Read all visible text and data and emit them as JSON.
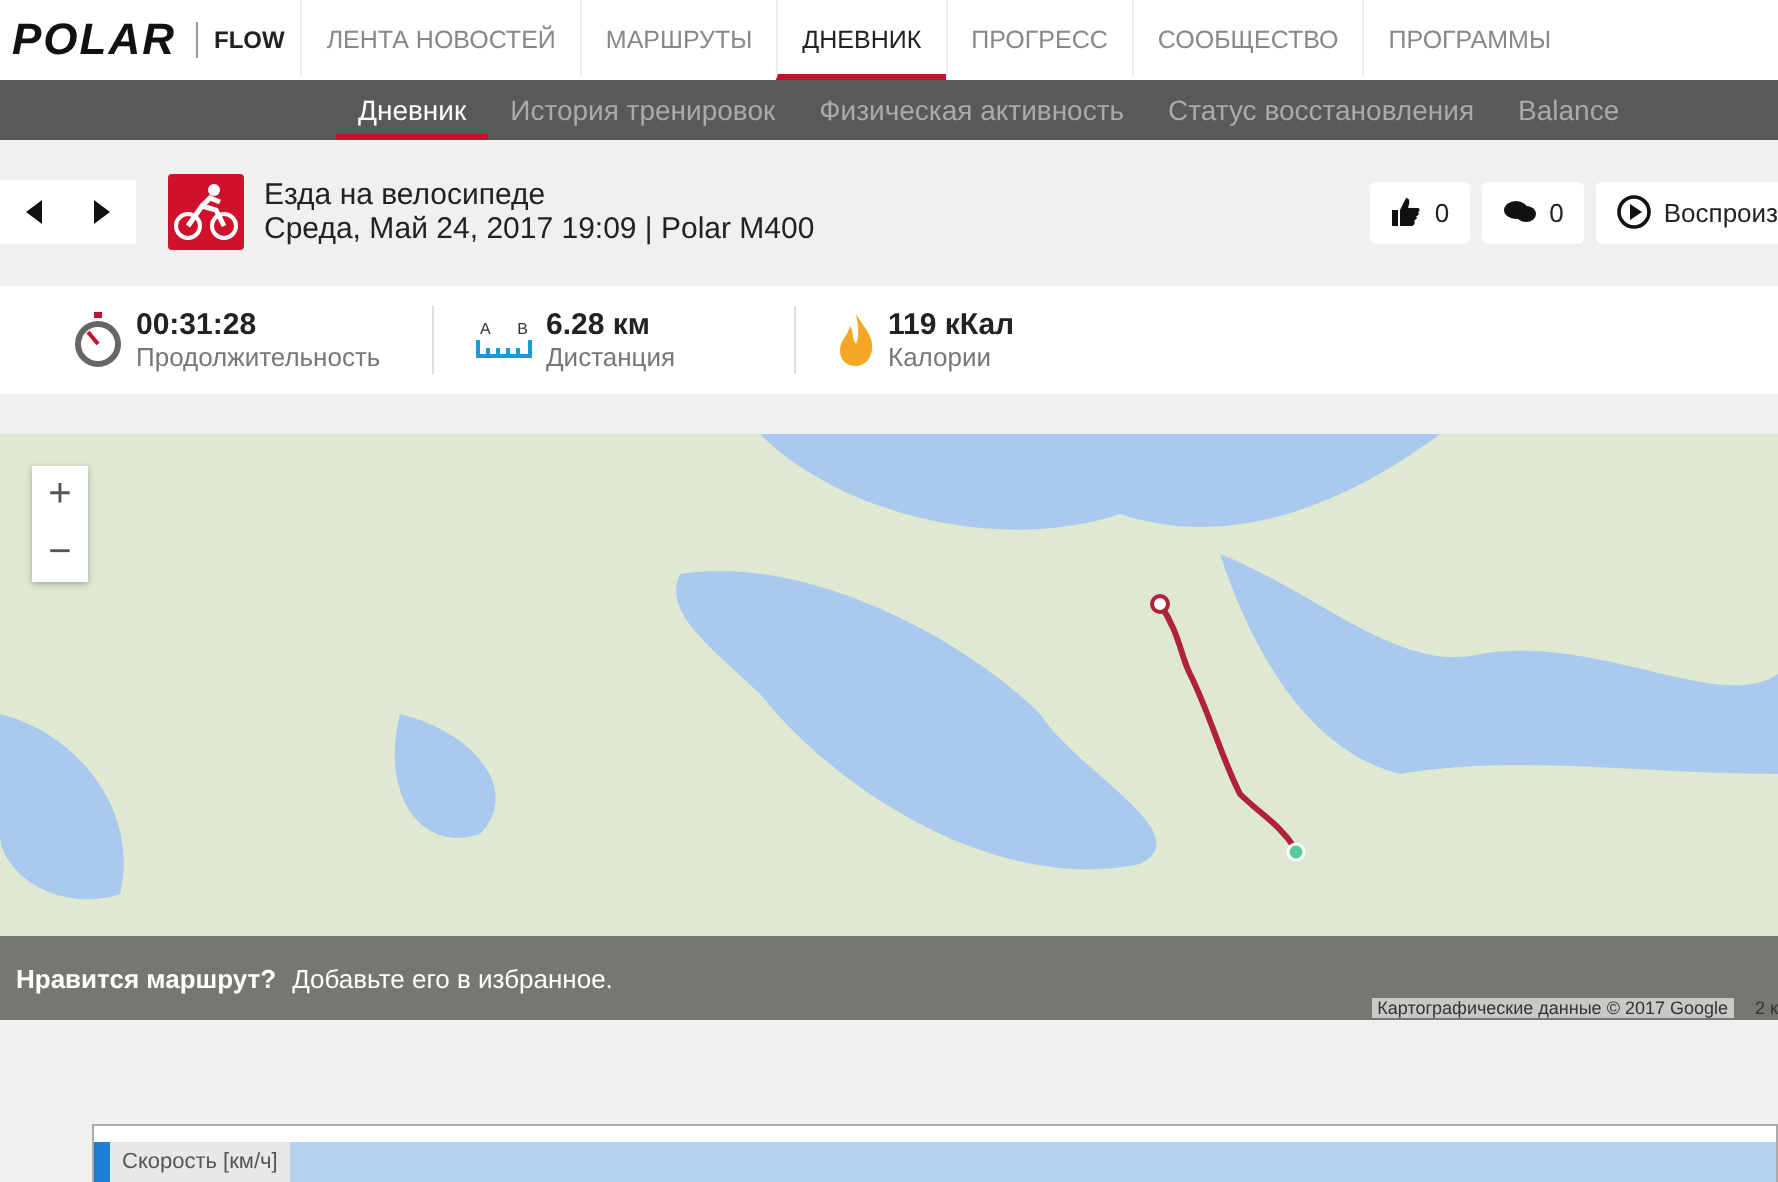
{
  "top_nav": {
    "logo": "POLAR",
    "product": "FLOW",
    "items": [
      {
        "label": "ЛЕНТА НОВОСТЕЙ",
        "selected": false
      },
      {
        "label": "МАРШРУТЫ",
        "selected": false
      },
      {
        "label": "ДНЕВНИК",
        "selected": true
      },
      {
        "label": "ПРОГРЕСС",
        "selected": false
      },
      {
        "label": "СООБЩЕСТВО",
        "selected": false
      },
      {
        "label": "ПРОГРАММЫ",
        "selected": false
      }
    ]
  },
  "sub_nav": {
    "items": [
      {
        "label": "Дневник",
        "selected": true
      },
      {
        "label": "История тренировок",
        "selected": false
      },
      {
        "label": "Физическая активность",
        "selected": false
      },
      {
        "label": "Статус восстановления",
        "selected": false
      },
      {
        "label": "Balance",
        "selected": false
      }
    ]
  },
  "workout": {
    "sport": "Езда на велосипеде",
    "subtitle": "Среда, Май 24, 2017 19:09 | Polar M400",
    "likes": "0",
    "comments": "0",
    "replay": "Воспроиз"
  },
  "stats": [
    {
      "kind": "duration",
      "value": "00:31:28",
      "label": "Продолжительность"
    },
    {
      "kind": "distance",
      "value": "6.28 км",
      "label": "Дистанция",
      "marker_from": "A",
      "marker_to": "B"
    },
    {
      "kind": "calories",
      "value": "119 кКал",
      "label": "Калории"
    }
  ],
  "map": {
    "zoom_in": "+",
    "zoom_out": "−",
    "banner_question": "Нравится маршрут?",
    "banner_prompt": "Добавьте его в избранное.",
    "attribution": "Картографические данные © 2017 Google",
    "scale": "2 к"
  },
  "chart": {
    "legend": "Скорость [км/ч]"
  }
}
